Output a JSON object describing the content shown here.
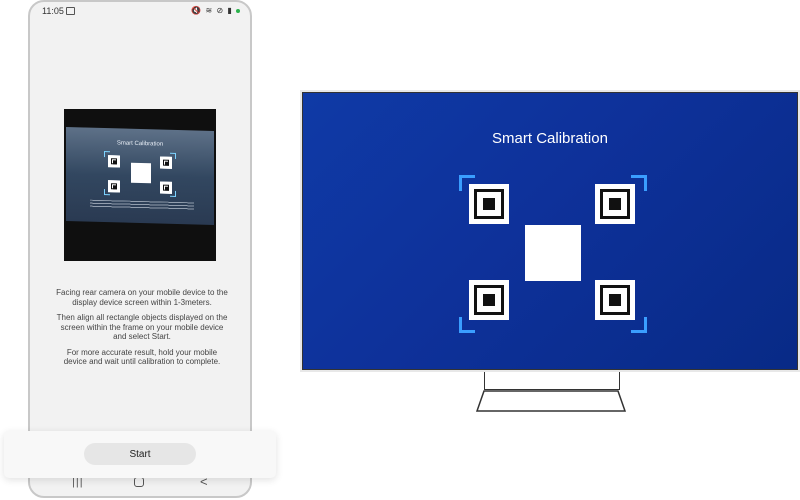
{
  "status_bar": {
    "time": "11:05",
    "icons": "🔇 ≋ ⊘ ▮",
    "indicator_color": "#2bb24c"
  },
  "camera_preview": {
    "title": "Smart Calibration"
  },
  "instructions": {
    "paragraph_1": "Facing rear camera on your mobile device to the display device screen within 1-3meters.",
    "paragraph_2": "Then align all rectangle objects displayed on the screen within the frame on your mobile device and select Start.",
    "paragraph_3": "For more accurate result, hold your mobile device and wait until calibration to complete."
  },
  "actions": {
    "start_label": "Start"
  },
  "nav": {
    "recent_icon": "|||",
    "back_icon": "<"
  },
  "tv": {
    "title": "Smart Calibration",
    "background_color": "#0e319a",
    "corner_color": "#3a9eff"
  }
}
